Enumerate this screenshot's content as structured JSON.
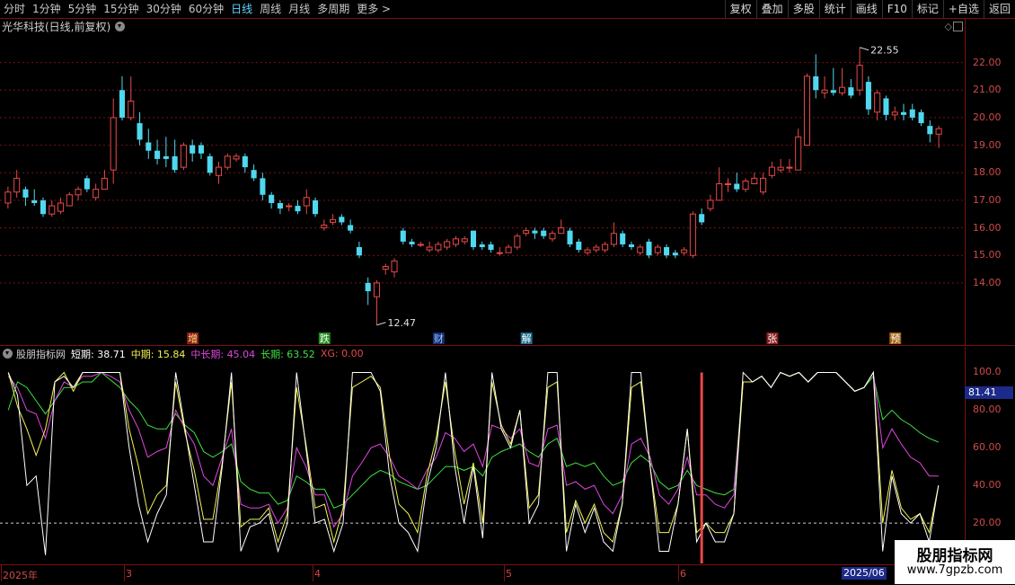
{
  "toolbar": {
    "periods": [
      "分时",
      "1分钟",
      "5分钟",
      "15分钟",
      "30分钟",
      "60分钟",
      "日线",
      "周线",
      "月线",
      "多周期",
      "更多 >"
    ],
    "active_period": "日线",
    "buttons": [
      "复权",
      "叠加",
      "多股",
      "统计",
      "画线",
      "F10",
      "标记",
      "+自选",
      "返回"
    ]
  },
  "stock": {
    "title": "光华科技(日线,前复权)"
  },
  "colors": {
    "up": "#e84848",
    "down": "#4fd8f0",
    "grid": "#7a1010",
    "axis_text": "#d04a4a",
    "short": "#ffffff",
    "mid": "#f2f250",
    "midlong": "#e046e0",
    "long": "#40e040",
    "xg": "#e84848"
  },
  "price_axis": {
    "labels": [
      "22.00",
      "21.00",
      "20.00",
      "19.00",
      "18.00",
      "17.00",
      "16.00",
      "15.00",
      "14.00"
    ]
  },
  "annotations": {
    "high": "22.55",
    "low": "12.47"
  },
  "event_markers": [
    {
      "label": "增",
      "bg": "#8a1f1f",
      "color": "#ffe070"
    },
    {
      "label": "跌",
      "bg": "#1e8a1e",
      "color": "#ffffff"
    },
    {
      "label": "财",
      "bg": "#1a2a70",
      "color": "#8fd0ff"
    },
    {
      "label": "解",
      "bg": "#1a6a8a",
      "color": "#ffffff"
    },
    {
      "label": "张",
      "bg": "#8a1f1f",
      "color": "#ffffff"
    },
    {
      "label": "预",
      "bg": "#a06010",
      "color": "#ffffff"
    }
  ],
  "indicator": {
    "name": "股朋指标网",
    "short": "短期: 38.71",
    "mid": "中期: 15.84",
    "midlong": "中长期: 45.04",
    "long": "长期: 63.52",
    "xg": "XG: 0.00",
    "axis_labels": [
      "100.0",
      "80.00",
      "60.00",
      "40.00",
      "20.00"
    ],
    "current_value": "81.41"
  },
  "date_axis": {
    "labels": [
      "2025年",
      "3",
      "4",
      "5",
      "6"
    ],
    "highlight": "2025/06"
  },
  "watermark": {
    "line1": "股朋指标网",
    "line2": "www.7gpzb.com"
  },
  "chart_data": {
    "type": "candlestick",
    "ylim": [
      12.3,
      22.9
    ],
    "candles": [
      [
        16.9,
        17.3,
        17.5,
        16.7
      ],
      [
        17.3,
        17.8,
        18.1,
        17.1
      ],
      [
        17.4,
        17.1,
        17.5,
        16.8
      ],
      [
        17.0,
        16.9,
        17.4,
        16.8
      ],
      [
        17.0,
        16.5,
        17.1,
        16.4
      ],
      [
        16.5,
        16.8,
        17.0,
        16.4
      ],
      [
        16.6,
        16.9,
        17.1,
        16.5
      ],
      [
        16.8,
        17.2,
        17.3,
        16.8
      ],
      [
        17.2,
        17.4,
        17.5,
        17.0
      ],
      [
        17.8,
        17.4,
        17.9,
        17.3
      ],
      [
        17.1,
        17.4,
        17.6,
        17.0
      ],
      [
        17.4,
        17.8,
        18.1,
        17.4
      ],
      [
        18.1,
        20.0,
        20.7,
        17.6
      ],
      [
        21.0,
        20.0,
        21.5,
        19.9
      ],
      [
        20.0,
        20.6,
        21.5,
        19.9
      ],
      [
        19.8,
        19.2,
        20.2,
        19.0
      ],
      [
        19.1,
        18.8,
        19.6,
        18.5
      ],
      [
        18.8,
        18.5,
        19.2,
        18.3
      ],
      [
        18.6,
        18.5,
        19.3,
        18.2
      ],
      [
        18.6,
        18.1,
        19.2,
        18.0
      ],
      [
        18.2,
        19.0,
        19.1,
        18.1
      ],
      [
        19.0,
        18.7,
        19.2,
        18.4
      ],
      [
        19.0,
        18.7,
        19.1,
        18.5
      ],
      [
        18.6,
        18.0,
        18.7,
        17.9
      ],
      [
        17.9,
        18.2,
        18.4,
        17.6
      ],
      [
        18.2,
        18.6,
        18.7,
        18.1
      ],
      [
        18.5,
        18.6,
        18.7,
        18.4
      ],
      [
        18.6,
        18.2,
        18.7,
        18.0
      ],
      [
        18.1,
        17.8,
        18.3,
        17.7
      ],
      [
        17.8,
        17.2,
        18.0,
        17.0
      ],
      [
        17.2,
        16.9,
        17.3,
        16.7
      ],
      [
        16.9,
        16.7,
        17.0,
        16.5
      ],
      [
        16.8,
        16.8,
        16.9,
        16.6
      ],
      [
        16.8,
        16.6,
        17.0,
        16.5
      ],
      [
        16.8,
        17.1,
        17.4,
        16.5
      ],
      [
        17.0,
        16.5,
        17.1,
        16.4
      ],
      [
        16.0,
        16.1,
        16.3,
        15.9
      ],
      [
        16.2,
        16.3,
        16.5,
        16.1
      ],
      [
        16.4,
        16.2,
        16.5,
        16.1
      ],
      [
        16.1,
        15.9,
        16.3,
        15.8
      ],
      [
        15.3,
        15.0,
        15.5,
        14.9
      ],
      [
        14.0,
        13.7,
        14.2,
        13.2
      ],
      [
        13.5,
        14.0,
        14.1,
        12.47
      ],
      [
        14.5,
        14.6,
        14.7,
        14.3
      ],
      [
        14.4,
        14.8,
        14.9,
        14.2
      ],
      [
        15.9,
        15.5,
        16.0,
        15.4
      ],
      [
        15.5,
        15.4,
        15.6,
        15.3
      ],
      [
        15.4,
        15.4,
        15.5,
        15.3
      ],
      [
        15.2,
        15.3,
        15.5,
        15.1
      ],
      [
        15.2,
        15.4,
        15.5,
        15.1
      ],
      [
        15.3,
        15.5,
        15.6,
        15.2
      ],
      [
        15.4,
        15.6,
        15.7,
        15.3
      ],
      [
        15.5,
        15.6,
        15.7,
        15.4
      ],
      [
        15.9,
        15.3,
        15.9,
        15.2
      ],
      [
        15.4,
        15.3,
        15.5,
        15.2
      ],
      [
        15.4,
        15.2,
        15.5,
        15.1
      ],
      [
        15.1,
        15.1,
        15.3,
        15.0
      ],
      [
        15.1,
        15.3,
        15.4,
        15.1
      ],
      [
        15.3,
        15.7,
        15.8,
        15.2
      ],
      [
        15.8,
        15.9,
        16.0,
        15.7
      ],
      [
        15.9,
        15.8,
        16.0,
        15.6
      ],
      [
        15.9,
        15.7,
        16.0,
        15.6
      ],
      [
        15.6,
        15.8,
        15.9,
        15.5
      ],
      [
        15.8,
        16.0,
        16.3,
        15.8
      ],
      [
        15.9,
        15.4,
        16.0,
        15.3
      ],
      [
        15.5,
        15.2,
        15.6,
        15.1
      ],
      [
        15.1,
        15.2,
        15.3,
        15.0
      ],
      [
        15.2,
        15.3,
        15.4,
        15.1
      ],
      [
        15.2,
        15.4,
        15.5,
        15.1
      ],
      [
        15.4,
        15.8,
        16.2,
        15.3
      ],
      [
        15.8,
        15.4,
        15.9,
        15.3
      ],
      [
        15.4,
        15.3,
        15.5,
        15.2
      ],
      [
        15.1,
        15.3,
        15.4,
        15.0
      ],
      [
        15.5,
        15.0,
        15.6,
        14.9
      ],
      [
        15.1,
        15.3,
        15.4,
        15.0
      ],
      [
        15.3,
        15.0,
        15.4,
        14.9
      ],
      [
        15.1,
        15.0,
        15.2,
        14.9
      ],
      [
        15.1,
        15.2,
        15.3,
        15.0
      ],
      [
        15.0,
        16.5,
        16.6,
        14.9
      ],
      [
        16.5,
        16.2,
        16.7,
        16.1
      ],
      [
        16.7,
        17.0,
        17.2,
        16.6
      ],
      [
        17.0,
        17.6,
        18.2,
        17.0
      ],
      [
        17.6,
        17.6,
        17.8,
        17.3
      ],
      [
        17.6,
        17.4,
        18.0,
        17.3
      ],
      [
        17.4,
        17.7,
        17.8,
        17.3
      ],
      [
        17.6,
        17.8,
        18.0,
        17.6
      ],
      [
        17.3,
        17.8,
        18.0,
        17.2
      ],
      [
        17.9,
        18.2,
        18.4,
        17.8
      ],
      [
        18.1,
        18.2,
        18.5,
        18.0
      ],
      [
        18.2,
        18.2,
        18.5,
        18.0
      ],
      [
        18.1,
        19.3,
        19.6,
        18.1
      ],
      [
        19.0,
        21.5,
        21.6,
        19.0
      ],
      [
        21.5,
        21.0,
        22.3,
        20.7
      ],
      [
        20.9,
        21.0,
        21.5,
        20.7
      ],
      [
        21.0,
        20.9,
        21.8,
        20.8
      ],
      [
        20.9,
        21.1,
        21.8,
        20.8
      ],
      [
        21.1,
        20.8,
        21.4,
        20.7
      ],
      [
        21.0,
        21.9,
        22.55,
        20.8
      ],
      [
        21.3,
        20.3,
        21.5,
        20.1
      ],
      [
        20.2,
        20.9,
        21.0,
        19.9
      ],
      [
        20.7,
        20.1,
        20.8,
        19.9
      ],
      [
        20.1,
        20.2,
        20.4,
        19.9
      ],
      [
        20.2,
        20.1,
        20.5,
        19.9
      ],
      [
        20.3,
        20.0,
        20.5,
        19.9
      ],
      [
        20.2,
        19.8,
        20.3,
        19.7
      ],
      [
        19.7,
        19.4,
        19.9,
        19.1
      ],
      [
        19.4,
        19.6,
        19.7,
        18.9
      ]
    ],
    "indicator": {
      "ylim": [
        0,
        105
      ],
      "series": [
        {
          "name": "短期",
          "values": [
            100,
            88,
            40,
            45,
            3,
            95,
            98,
            92,
            100,
            100,
            100,
            100,
            100,
            60,
            30,
            10,
            25,
            35,
            100,
            70,
            40,
            10,
            10,
            50,
            100,
            5,
            18,
            20,
            25,
            5,
            20,
            100,
            60,
            20,
            22,
            5,
            20,
            100,
            100,
            100,
            90,
            45,
            20,
            15,
            5,
            40,
            60,
            100,
            50,
            20,
            50,
            12,
            100,
            70,
            60,
            80,
            20,
            30,
            100,
            100,
            5,
            30,
            15,
            28,
            10,
            5,
            30,
            100,
            100,
            50,
            5,
            5,
            30,
            70,
            10,
            20,
            10,
            10,
            25,
            100,
            95,
            98,
            92,
            100,
            98,
            100,
            95,
            100,
            100,
            100,
            95,
            90,
            92,
            100,
            5,
            45,
            25,
            20,
            25,
            10,
            40
          ]
        },
        {
          "name": "中期",
          "values": [
            100,
            82,
            70,
            56,
            70,
            95,
            100,
            90,
            100,
            100,
            100,
            100,
            100,
            70,
            50,
            25,
            35,
            40,
            95,
            68,
            48,
            22,
            22,
            52,
            95,
            18,
            22,
            22,
            28,
            10,
            25,
            92,
            62,
            28,
            30,
            10,
            28,
            92,
            95,
            98,
            92,
            55,
            30,
            25,
            15,
            45,
            65,
            95,
            58,
            30,
            52,
            20,
            95,
            72,
            62,
            80,
            28,
            35,
            92,
            95,
            15,
            32,
            20,
            30,
            15,
            10,
            30,
            92,
            95,
            50,
            15,
            15,
            30,
            70,
            15,
            20,
            15,
            15,
            25,
            95,
            95,
            98,
            92,
            100,
            98,
            100,
            95,
            100,
            100,
            100,
            95,
            90,
            92,
            100,
            20,
            48,
            28,
            22,
            25,
            15,
            40
          ]
        },
        {
          "name": "中长期",
          "values": [
            98,
            92,
            80,
            78,
            65,
            85,
            95,
            92,
            98,
            98,
            100,
            98,
            95,
            80,
            70,
            55,
            58,
            60,
            80,
            70,
            62,
            45,
            40,
            55,
            70,
            30,
            28,
            28,
            30,
            20,
            28,
            60,
            50,
            35,
            35,
            18,
            25,
            45,
            52,
            60,
            62,
            55,
            45,
            42,
            38,
            48,
            55,
            68,
            65,
            58,
            62,
            50,
            72,
            70,
            65,
            70,
            52,
            50,
            70,
            72,
            40,
            42,
            38,
            40,
            30,
            25,
            35,
            62,
            65,
            55,
            35,
            30,
            38,
            55,
            35,
            35,
            30,
            28,
            35,
            95,
            95,
            98,
            92,
            100,
            98,
            100,
            95,
            100,
            100,
            100,
            95,
            90,
            92,
            100,
            60,
            70,
            62,
            55,
            52,
            45,
            45
          ]
        },
        {
          "name": "长期",
          "values": [
            80,
            95,
            92,
            85,
            78,
            85,
            92,
            92,
            95,
            95,
            100,
            96,
            92,
            85,
            80,
            72,
            70,
            70,
            78,
            72,
            68,
            58,
            55,
            58,
            62,
            42,
            38,
            36,
            36,
            30,
            32,
            45,
            42,
            38,
            38,
            28,
            30,
            35,
            40,
            45,
            48,
            46,
            42,
            40,
            38,
            40,
            45,
            50,
            50,
            48,
            50,
            45,
            55,
            58,
            60,
            62,
            58,
            55,
            62,
            65,
            50,
            52,
            50,
            52,
            45,
            40,
            42,
            52,
            56,
            52,
            42,
            38,
            40,
            48,
            40,
            38,
            36,
            35,
            38,
            95,
            95,
            98,
            92,
            100,
            98,
            100,
            95,
            100,
            100,
            100,
            95,
            90,
            92,
            98,
            75,
            80,
            75,
            72,
            68,
            65,
            63
          ]
        }
      ],
      "xg_index": 79
    }
  }
}
